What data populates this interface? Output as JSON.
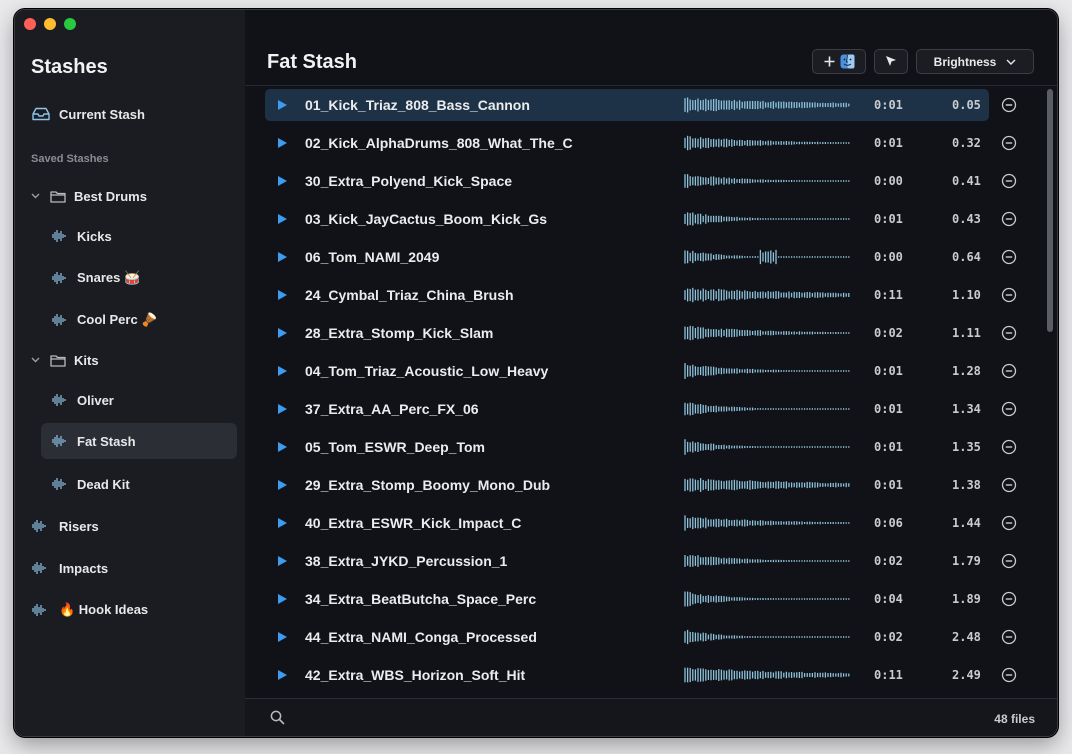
{
  "sidebar": {
    "title": "Stashes",
    "current": "Current Stash",
    "saved_label": "Saved Stashes",
    "groups": [
      {
        "label": "Best Drums"
      },
      {
        "label": "Kits"
      }
    ],
    "items": [
      {
        "label": "Kicks"
      },
      {
        "label": "Snares 🥁"
      },
      {
        "label": "Cool Perc 🪘"
      },
      {
        "label": "Oliver"
      },
      {
        "label": "Fat Stash"
      },
      {
        "label": "Dead Kit"
      },
      {
        "label": "Risers"
      },
      {
        "label": "Impacts"
      },
      {
        "label": "🔥 Hook Ideas"
      }
    ]
  },
  "main": {
    "title": "Fat Stash",
    "brightness_label": "Brightness",
    "footer_count": "48 files"
  },
  "files": [
    {
      "name": "01_Kick_Triaz_808_Bass_Cannon",
      "duration": "0:01",
      "value": "0.05",
      "selected": true
    },
    {
      "name": "02_Kick_AlphaDrums_808_What_The_C",
      "duration": "0:01",
      "value": "0.32"
    },
    {
      "name": "30_Extra_Polyend_Kick_Space",
      "duration": "0:00",
      "value": "0.41"
    },
    {
      "name": "03_Kick_JayCactus_Boom_Kick_Gs",
      "duration": "0:01",
      "value": "0.43"
    },
    {
      "name": "06_Tom_NAMI_2049",
      "duration": "0:00",
      "value": "0.64"
    },
    {
      "name": "24_Cymbal_Triaz_China_Brush",
      "duration": "0:11",
      "value": "1.10"
    },
    {
      "name": "28_Extra_Stomp_Kick_Slam",
      "duration": "0:02",
      "value": "1.11"
    },
    {
      "name": "04_Tom_Triaz_Acoustic_Low_Heavy",
      "duration": "0:01",
      "value": "1.28"
    },
    {
      "name": "37_Extra_AA_Perc_FX_06",
      "duration": "0:01",
      "value": "1.34"
    },
    {
      "name": "05_Tom_ESWR_Deep_Tom",
      "duration": "0:01",
      "value": "1.35"
    },
    {
      "name": "29_Extra_Stomp_Boomy_Mono_Dub",
      "duration": "0:01",
      "value": "1.38"
    },
    {
      "name": "40_Extra_ESWR_Kick_Impact_C",
      "duration": "0:06",
      "value": "1.44"
    },
    {
      "name": "38_Extra_JYKD_Percussion_1",
      "duration": "0:02",
      "value": "1.79"
    },
    {
      "name": "34_Extra_BeatButcha_Space_Perc",
      "duration": "0:04",
      "value": "1.89"
    },
    {
      "name": "44_Extra_NAMI_Conga_Processed",
      "duration": "0:02",
      "value": "2.48"
    },
    {
      "name": "42_Extra_WBS_Horizon_Soft_Hit",
      "duration": "0:11",
      "value": "2.49"
    }
  ],
  "colors": {
    "accent": "#3d9bf0",
    "waveform": "#8fc3dc",
    "selected_row": "#1d3246"
  }
}
